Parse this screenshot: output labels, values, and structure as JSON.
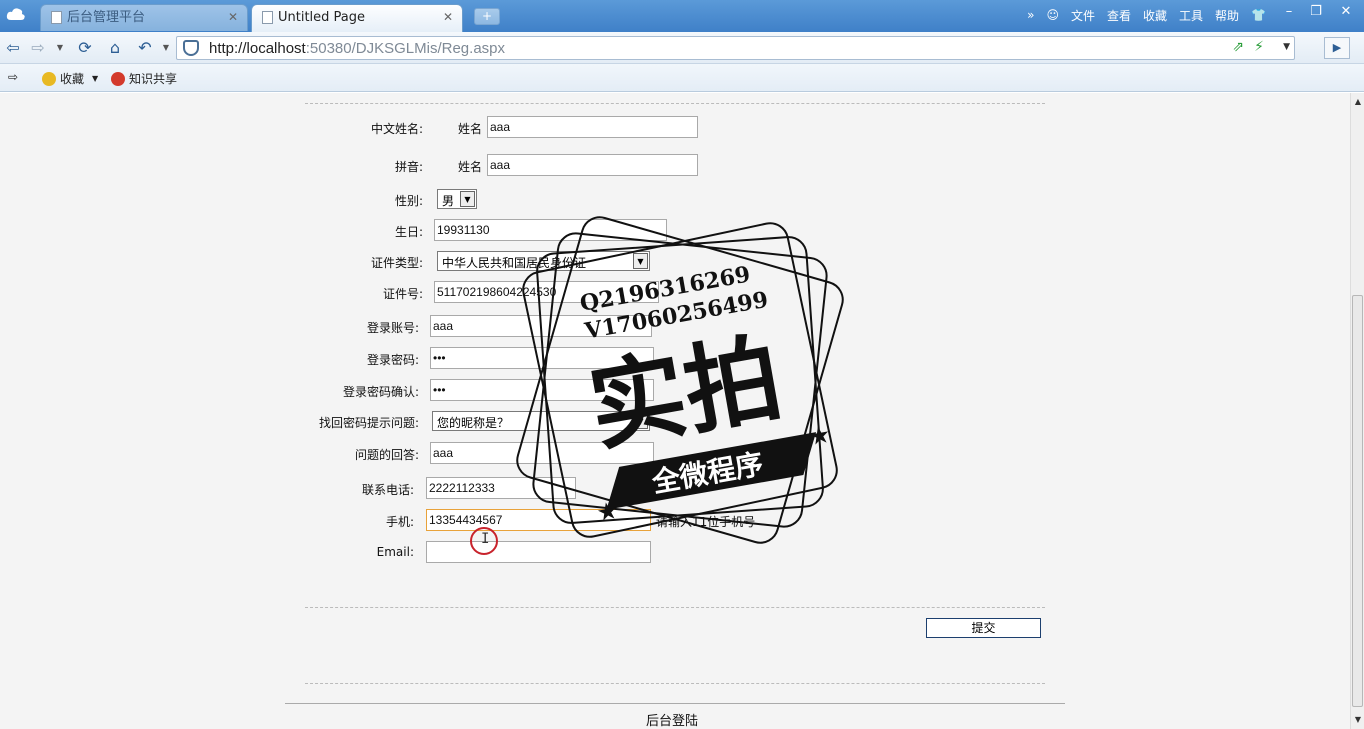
{
  "browser": {
    "tabs": [
      {
        "label": "后台管理平台",
        "active": false
      },
      {
        "label": "Untitled Page",
        "active": true
      }
    ],
    "new_tab_symbol": "+",
    "menu": [
      "文件",
      "查看",
      "收藏",
      "工具",
      "帮助"
    ],
    "address": {
      "host": "http://localhost",
      "rest": ":50380/DJKSGLMis/Reg.aspx"
    },
    "bookmarks": [
      {
        "label": "收藏",
        "icon": "star-add-icon"
      },
      {
        "label": "知识共享",
        "icon": "share-icon"
      }
    ],
    "icons": [
      "back-icon",
      "forward-icon",
      "refresh-icon",
      "home-icon",
      "undo-icon",
      "shield-icon",
      "go-icon"
    ]
  },
  "form": {
    "chinese_name": {
      "label": "中文姓名:",
      "sub": "姓名",
      "value": "aaa"
    },
    "pinyin": {
      "label": "拼音:",
      "sub": "姓名",
      "value": "aaa"
    },
    "gender": {
      "label": "性别:",
      "value": "男"
    },
    "birthday": {
      "label": "生日:",
      "value": "19931130"
    },
    "id_type": {
      "label": "证件类型:",
      "value": "中华人民共和国居民身份证"
    },
    "id_number": {
      "label": "证件号:",
      "value": "511702198604224530"
    },
    "login_account": {
      "label": "登录账号:",
      "value": "aaa"
    },
    "login_password": {
      "label": "登录密码:",
      "value": "•••"
    },
    "login_password_confirm": {
      "label": "登录密码确认:",
      "value": "•••"
    },
    "recovery_question": {
      "label": "找回密码提示问题:",
      "value": "您的昵称是？"
    },
    "answer": {
      "label": "问题的回答:",
      "value": "aaa"
    },
    "phone": {
      "label": "联系电话:",
      "value": "2222112333"
    },
    "mobile": {
      "label": "手机:",
      "value": "13354434567",
      "hint": "请输入11位手机号"
    },
    "email": {
      "label": "Email:",
      "value": ""
    },
    "submit_label": "提交"
  },
  "footer": {
    "link": "后台登陆"
  },
  "watermark": {
    "line1": "Q2196316269",
    "line2": "V17060256499",
    "big": "实拍",
    "banner": "全微程序"
  },
  "colors": {
    "chrome_blue": "#3f80c8",
    "focus_border": "#e8a23a",
    "cursor_ring": "#c8232c"
  }
}
